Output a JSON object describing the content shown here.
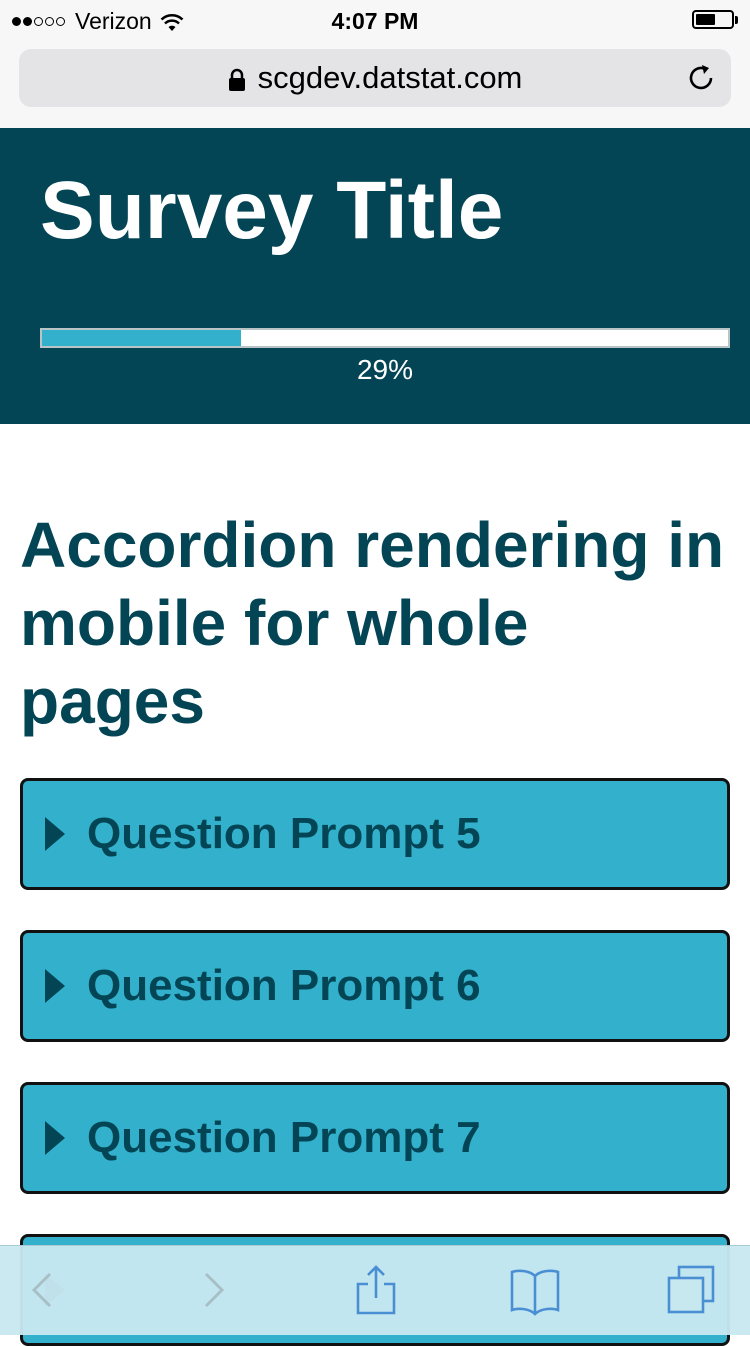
{
  "status_bar": {
    "carrier": "Verizon",
    "time": "4:07 PM",
    "signal_bars_filled": 2,
    "signal_bars_total": 5,
    "battery_level": 0.55
  },
  "browser": {
    "url": "scgdev.datstat.com"
  },
  "survey": {
    "title": "Survey Title",
    "progress_label": "29%",
    "progress_value": 0.29
  },
  "page": {
    "heading": "Accordion rendering in mobile for whole pages"
  },
  "accordion": {
    "items": [
      {
        "label": "Question Prompt 5"
      },
      {
        "label": "Question Prompt 6"
      },
      {
        "label": "Question Prompt 7"
      },
      {
        "label": ""
      }
    ]
  },
  "toolbar": {
    "icons": [
      "back-icon",
      "forward-icon",
      "share-icon",
      "bookmarks-icon",
      "tabs-icon"
    ]
  },
  "colors": {
    "header_bg": "#034555",
    "accent": "#33b1cc",
    "heading_text": "#034555",
    "toolbar_tint": "#4a8fd4"
  }
}
